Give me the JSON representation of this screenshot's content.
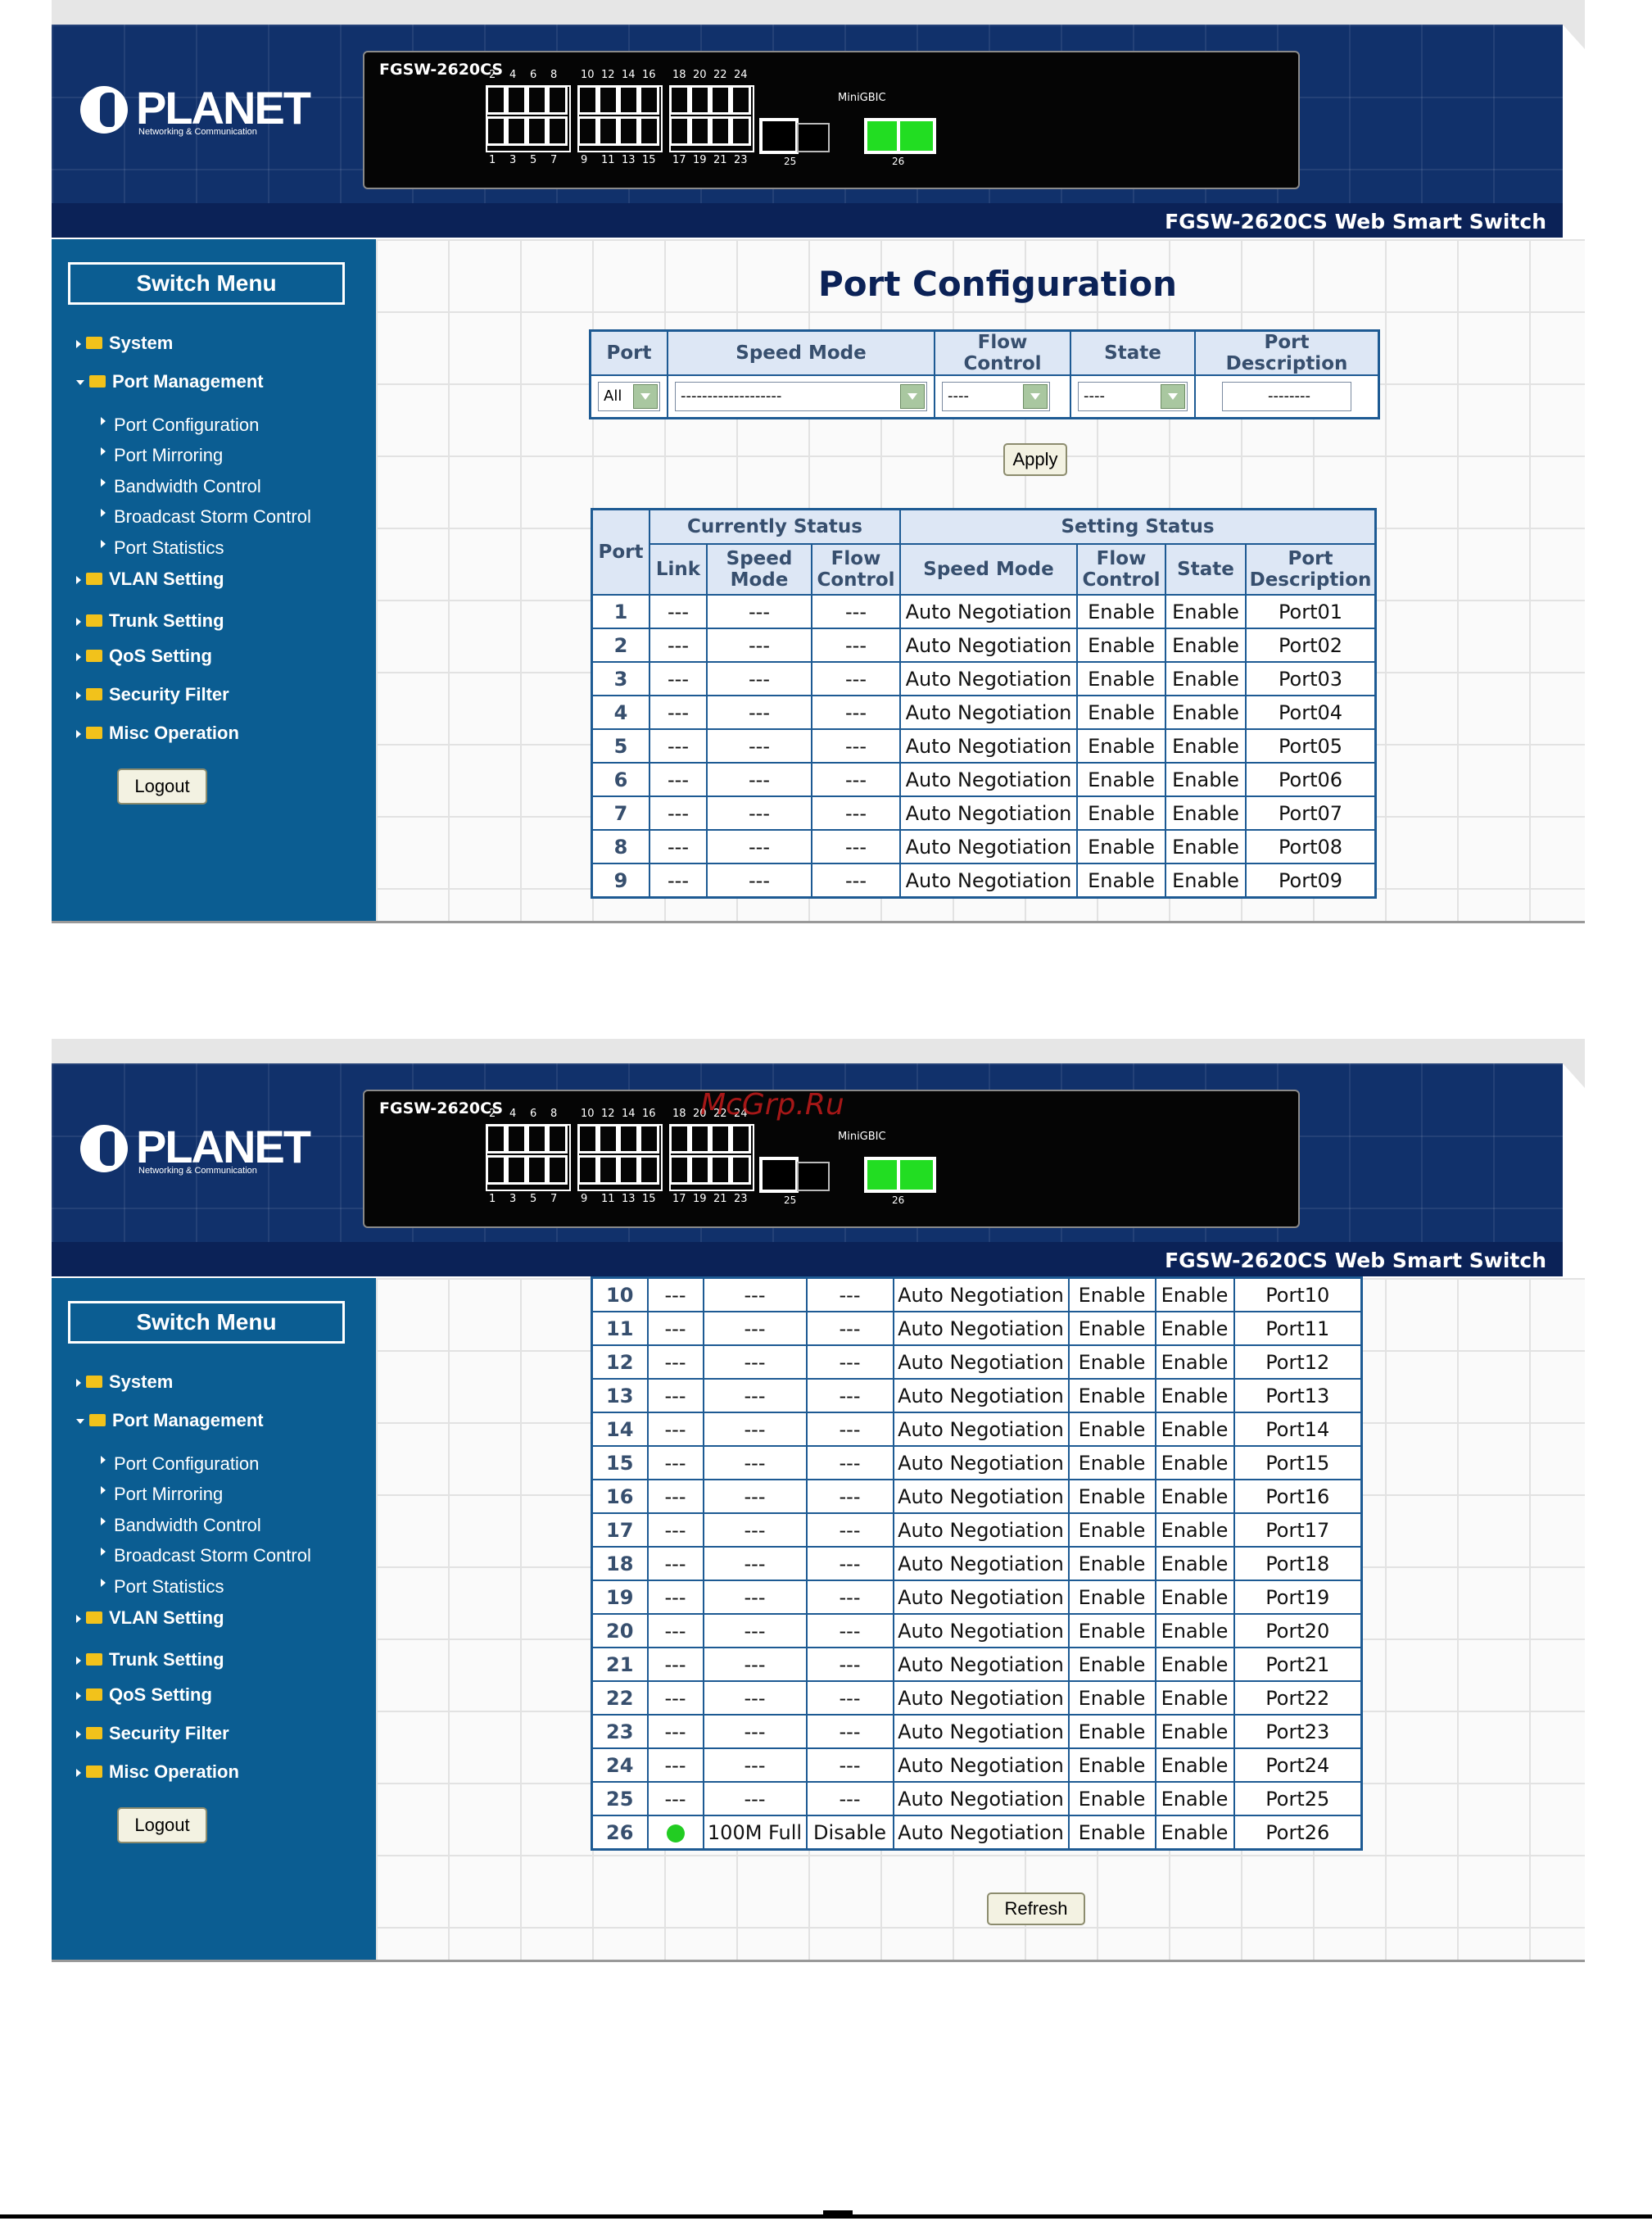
{
  "header": {
    "logo_text": "PLANET",
    "logo_sub": "Networking & Communication",
    "model": "FGSW-2620CS",
    "switch_name": "FGSW-2620CS Web Smart Switch",
    "port_top_labels": [
      "2",
      "4",
      "6",
      "8",
      "10",
      "12",
      "14",
      "16",
      "18",
      "20",
      "22",
      "24"
    ],
    "port_bottom_labels": [
      "1",
      "3",
      "5",
      "7",
      "9",
      "11",
      "13",
      "15",
      "17",
      "19",
      "21",
      "23"
    ],
    "minigbic_label": "MiniGBIC",
    "sfp_labels": [
      "25",
      "26"
    ],
    "colors": {
      "navy": "#11316b",
      "sfp_active": "#22dd22"
    }
  },
  "sidebar": {
    "title": "Switch Menu",
    "items": [
      {
        "label": "System",
        "expanded": false
      },
      {
        "label": "Port Management",
        "expanded": true
      },
      {
        "label": "VLAN Setting",
        "expanded": false
      },
      {
        "label": "Trunk Setting",
        "expanded": false
      },
      {
        "label": "QoS Setting",
        "expanded": false
      },
      {
        "label": "Security Filter",
        "expanded": false
      },
      {
        "label": "Misc Operation",
        "expanded": false
      }
    ],
    "sub_items": [
      "Port Configuration",
      "Port Mirroring",
      "Bandwidth Control",
      "Broadcast Storm Control",
      "Port Statistics"
    ],
    "logout": "Logout"
  },
  "config": {
    "title": "Port Configuration",
    "headers": [
      "Port",
      "Speed Mode",
      "Flow Control",
      "State",
      "Port Description"
    ],
    "port_value": "All",
    "speed_value": "-------------------",
    "flow_value": "----",
    "state_value": "----",
    "description_value": "--------",
    "apply": "Apply"
  },
  "status_table": {
    "port_header": "Port",
    "group_current": "Currently Status",
    "group_setting": "Setting Status",
    "col_link": "Link",
    "col_speed_mode": "Speed Mode",
    "col_flow_control": "Flow Control",
    "col_state": "State",
    "col_port_description": "Port Description",
    "rows": [
      {
        "port": "1",
        "link": "---",
        "speed": "---",
        "flow": "---",
        "set_speed": "Auto Negotiation",
        "set_flow": "Enable",
        "state": "Enable",
        "desc": "Port01"
      },
      {
        "port": "2",
        "link": "---",
        "speed": "---",
        "flow": "---",
        "set_speed": "Auto Negotiation",
        "set_flow": "Enable",
        "state": "Enable",
        "desc": "Port02"
      },
      {
        "port": "3",
        "link": "---",
        "speed": "---",
        "flow": "---",
        "set_speed": "Auto Negotiation",
        "set_flow": "Enable",
        "state": "Enable",
        "desc": "Port03"
      },
      {
        "port": "4",
        "link": "---",
        "speed": "---",
        "flow": "---",
        "set_speed": "Auto Negotiation",
        "set_flow": "Enable",
        "state": "Enable",
        "desc": "Port04"
      },
      {
        "port": "5",
        "link": "---",
        "speed": "---",
        "flow": "---",
        "set_speed": "Auto Negotiation",
        "set_flow": "Enable",
        "state": "Enable",
        "desc": "Port05"
      },
      {
        "port": "6",
        "link": "---",
        "speed": "---",
        "flow": "---",
        "set_speed": "Auto Negotiation",
        "set_flow": "Enable",
        "state": "Enable",
        "desc": "Port06"
      },
      {
        "port": "7",
        "link": "---",
        "speed": "---",
        "flow": "---",
        "set_speed": "Auto Negotiation",
        "set_flow": "Enable",
        "state": "Enable",
        "desc": "Port07"
      },
      {
        "port": "8",
        "link": "---",
        "speed": "---",
        "flow": "---",
        "set_speed": "Auto Negotiation",
        "set_flow": "Enable",
        "state": "Enable",
        "desc": "Port08"
      },
      {
        "port": "9",
        "link": "---",
        "speed": "---",
        "flow": "---",
        "set_speed": "Auto Negotiation",
        "set_flow": "Enable",
        "state": "Enable",
        "desc": "Port09"
      },
      {
        "port": "10",
        "link": "---",
        "speed": "---",
        "flow": "---",
        "set_speed": "Auto Negotiation",
        "set_flow": "Enable",
        "state": "Enable",
        "desc": "Port10"
      },
      {
        "port": "11",
        "link": "---",
        "speed": "---",
        "flow": "---",
        "set_speed": "Auto Negotiation",
        "set_flow": "Enable",
        "state": "Enable",
        "desc": "Port11"
      },
      {
        "port": "12",
        "link": "---",
        "speed": "---",
        "flow": "---",
        "set_speed": "Auto Negotiation",
        "set_flow": "Enable",
        "state": "Enable",
        "desc": "Port12"
      },
      {
        "port": "13",
        "link": "---",
        "speed": "---",
        "flow": "---",
        "set_speed": "Auto Negotiation",
        "set_flow": "Enable",
        "state": "Enable",
        "desc": "Port13"
      },
      {
        "port": "14",
        "link": "---",
        "speed": "---",
        "flow": "---",
        "set_speed": "Auto Negotiation",
        "set_flow": "Enable",
        "state": "Enable",
        "desc": "Port14"
      },
      {
        "port": "15",
        "link": "---",
        "speed": "---",
        "flow": "---",
        "set_speed": "Auto Negotiation",
        "set_flow": "Enable",
        "state": "Enable",
        "desc": "Port15"
      },
      {
        "port": "16",
        "link": "---",
        "speed": "---",
        "flow": "---",
        "set_speed": "Auto Negotiation",
        "set_flow": "Enable",
        "state": "Enable",
        "desc": "Port16"
      },
      {
        "port": "17",
        "link": "---",
        "speed": "---",
        "flow": "---",
        "set_speed": "Auto Negotiation",
        "set_flow": "Enable",
        "state": "Enable",
        "desc": "Port17"
      },
      {
        "port": "18",
        "link": "---",
        "speed": "---",
        "flow": "---",
        "set_speed": "Auto Negotiation",
        "set_flow": "Enable",
        "state": "Enable",
        "desc": "Port18"
      },
      {
        "port": "19",
        "link": "---",
        "speed": "---",
        "flow": "---",
        "set_speed": "Auto Negotiation",
        "set_flow": "Enable",
        "state": "Enable",
        "desc": "Port19"
      },
      {
        "port": "20",
        "link": "---",
        "speed": "---",
        "flow": "---",
        "set_speed": "Auto Negotiation",
        "set_flow": "Enable",
        "state": "Enable",
        "desc": "Port20"
      },
      {
        "port": "21",
        "link": "---",
        "speed": "---",
        "flow": "---",
        "set_speed": "Auto Negotiation",
        "set_flow": "Enable",
        "state": "Enable",
        "desc": "Port21"
      },
      {
        "port": "22",
        "link": "---",
        "speed": "---",
        "flow": "---",
        "set_speed": "Auto Negotiation",
        "set_flow": "Enable",
        "state": "Enable",
        "desc": "Port22"
      },
      {
        "port": "23",
        "link": "---",
        "speed": "---",
        "flow": "---",
        "set_speed": "Auto Negotiation",
        "set_flow": "Enable",
        "state": "Enable",
        "desc": "Port23"
      },
      {
        "port": "24",
        "link": "---",
        "speed": "---",
        "flow": "---",
        "set_speed": "Auto Negotiation",
        "set_flow": "Enable",
        "state": "Enable",
        "desc": "Port24"
      },
      {
        "port": "25",
        "link": "---",
        "speed": "---",
        "flow": "---",
        "set_speed": "Auto Negotiation",
        "set_flow": "Enable",
        "state": "Enable",
        "desc": "Port25"
      },
      {
        "port": "26",
        "link": "link-up",
        "speed": "100M Full",
        "flow": "Disable",
        "set_speed": "Auto Negotiation",
        "set_flow": "Enable",
        "state": "Enable",
        "desc": "Port26"
      }
    ],
    "refresh": "Refresh"
  },
  "watermark": "McGrp.Ru"
}
